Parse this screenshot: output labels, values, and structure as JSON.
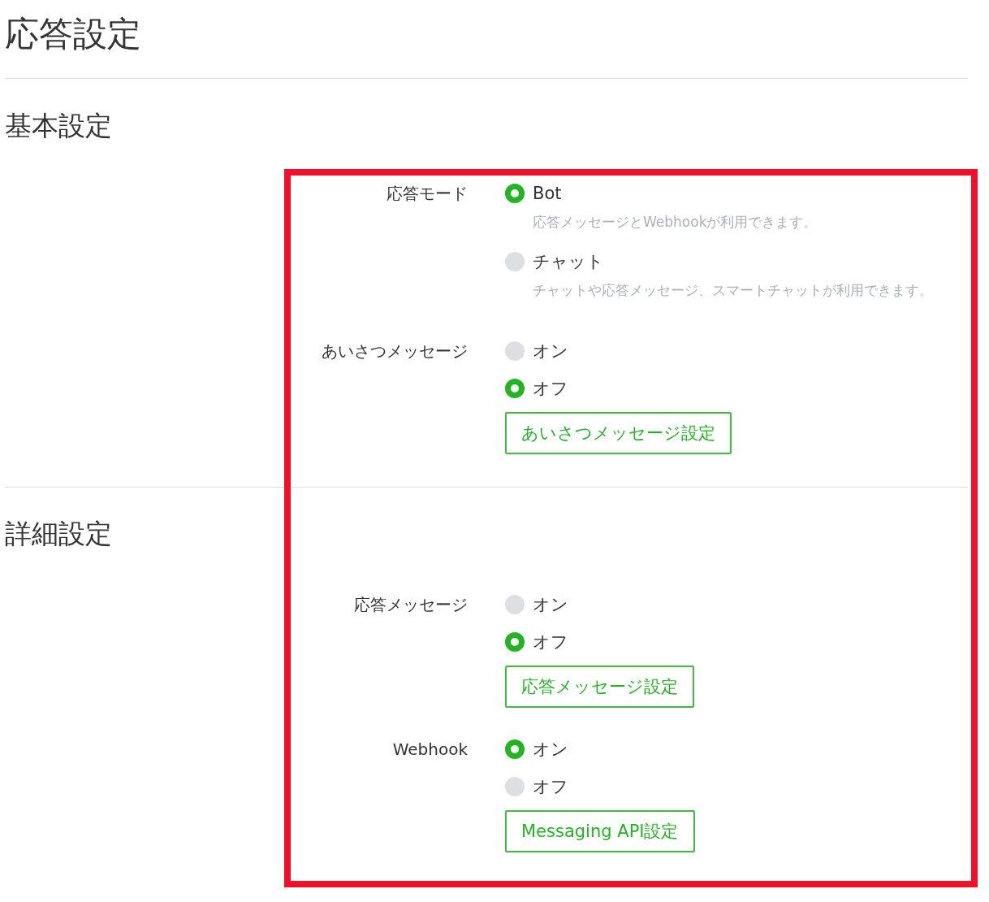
{
  "page": {
    "title": "応答設定"
  },
  "sections": [
    {
      "title": "基本設定",
      "settings": [
        {
          "label": "応答モード",
          "options": [
            {
              "label": "Bot",
              "selected": true,
              "description": "応答メッセージとWebhookが利用できます。"
            },
            {
              "label": "チャット",
              "selected": false,
              "description": "チャットや応答メッセージ、スマートチャットが利用できます。"
            }
          ]
        },
        {
          "label": "あいさつメッセージ",
          "options": [
            {
              "label": "オン",
              "selected": false
            },
            {
              "label": "オフ",
              "selected": true
            }
          ],
          "button": "あいさつメッセージ設定"
        }
      ]
    },
    {
      "title": "詳細設定",
      "settings": [
        {
          "label": "応答メッセージ",
          "options": [
            {
              "label": "オン",
              "selected": false
            },
            {
              "label": "オフ",
              "selected": true
            }
          ],
          "button": "応答メッセージ設定"
        },
        {
          "label": "Webhook",
          "options": [
            {
              "label": "オン",
              "selected": true
            },
            {
              "label": "オフ",
              "selected": false
            }
          ],
          "button": "Messaging API設定"
        }
      ]
    }
  ]
}
